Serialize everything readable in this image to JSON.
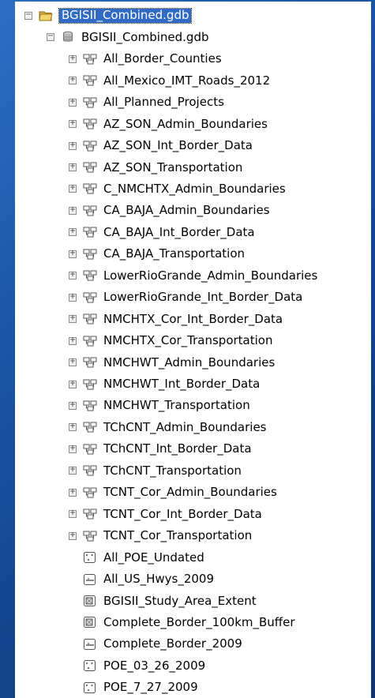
{
  "tree": {
    "root": {
      "label": "BGISII_Combined.gdb",
      "icon": "folder-open-icon"
    },
    "gdb": {
      "label": "BGISII_Combined.gdb",
      "icon": "geodatabase-icon"
    },
    "items": [
      {
        "label": "All_Border_Counties",
        "icon": "feature-dataset-icon"
      },
      {
        "label": "All_Mexico_IMT_Roads_2012",
        "icon": "feature-dataset-icon"
      },
      {
        "label": "All_Planned_Projects",
        "icon": "feature-dataset-icon"
      },
      {
        "label": "AZ_SON_Admin_Boundaries",
        "icon": "feature-dataset-icon"
      },
      {
        "label": "AZ_SON_Int_Border_Data",
        "icon": "feature-dataset-icon"
      },
      {
        "label": "AZ_SON_Transportation",
        "icon": "feature-dataset-icon"
      },
      {
        "label": "C_NMCHTX_Admin_Boundaries",
        "icon": "feature-dataset-icon"
      },
      {
        "label": "CA_BAJA_Admin_Boundaries",
        "icon": "feature-dataset-icon"
      },
      {
        "label": "CA_BAJA_Int_Border_Data",
        "icon": "feature-dataset-icon"
      },
      {
        "label": "CA_BAJA_Transportation",
        "icon": "feature-dataset-icon"
      },
      {
        "label": "LowerRioGrande_Admin_Boundaries",
        "icon": "feature-dataset-icon"
      },
      {
        "label": "LowerRioGrande_Int_Border_Data",
        "icon": "feature-dataset-icon"
      },
      {
        "label": "NMCHTX_Cor_Int_Border_Data",
        "icon": "feature-dataset-icon"
      },
      {
        "label": "NMCHTX_Cor_Transportation",
        "icon": "feature-dataset-icon"
      },
      {
        "label": "NMCHWT_Admin_Boundaries",
        "icon": "feature-dataset-icon"
      },
      {
        "label": "NMCHWT_Int_Border_Data",
        "icon": "feature-dataset-icon"
      },
      {
        "label": "NMCHWT_Transportation",
        "icon": "feature-dataset-icon"
      },
      {
        "label": "TChCNT_Admin_Boundaries",
        "icon": "feature-dataset-icon"
      },
      {
        "label": "TChCNT_Int_Border_Data",
        "icon": "feature-dataset-icon"
      },
      {
        "label": "TChCNT_Transportation",
        "icon": "feature-dataset-icon"
      },
      {
        "label": "TCNT_Cor_Admin_Boundaries",
        "icon": "feature-dataset-icon"
      },
      {
        "label": "TCNT_Cor_Int_Border_Data",
        "icon": "feature-dataset-icon"
      },
      {
        "label": "TCNT_Cor_Transportation",
        "icon": "feature-dataset-icon"
      },
      {
        "label": "All_POE_Undated",
        "icon": "point-feature-class-icon"
      },
      {
        "label": "All_US_Hwys_2009",
        "icon": "line-feature-class-icon"
      },
      {
        "label": "BGISII_Study_Area_Extent",
        "icon": "polygon-feature-class-icon"
      },
      {
        "label": "Complete_Border_100km_Buffer",
        "icon": "polygon-feature-class-icon"
      },
      {
        "label": "Complete_Border_2009",
        "icon": "line-feature-class-icon"
      },
      {
        "label": "POE_03_26_2009",
        "icon": "point-feature-class-icon"
      },
      {
        "label": "POE_7_27_2009",
        "icon": "point-feature-class-icon"
      }
    ]
  },
  "colors": {
    "selection": "#316ac5",
    "background": "#1a54a2"
  }
}
